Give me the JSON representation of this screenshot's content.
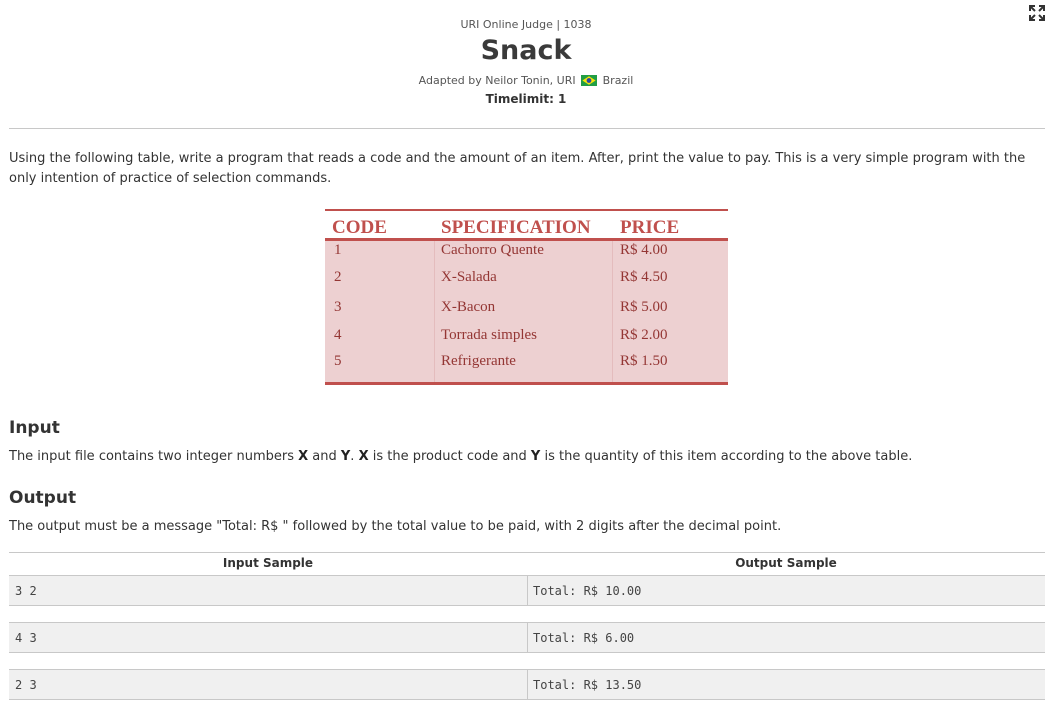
{
  "header": {
    "judge_line": "URI Online Judge | 1038",
    "title": "Snack",
    "adapted_prefix": "Adapted by Neilor Tonin, URI",
    "country": "Brazil",
    "timelimit": "Timelimit: 1"
  },
  "description": "Using the following table, write a program that reads a code and the amount of an item. After, print the value to pay. This is a very simple program with the only intention of practice of selection commands.",
  "price_table": {
    "headers": [
      "CODE",
      "SPECIFICATION",
      "PRICE"
    ],
    "rows": [
      [
        "1",
        "Cachorro Quente",
        "R$ 4.00"
      ],
      [
        "2",
        "X-Salada",
        "R$ 4.50"
      ],
      [
        "3",
        "X-Bacon",
        "R$ 5.00"
      ],
      [
        "4",
        "Torrada simples",
        "R$ 2.00"
      ],
      [
        "5",
        "Refrigerante",
        "R$ 1.50"
      ]
    ]
  },
  "input": {
    "title": "Input",
    "t1": "The input file contains two integer numbers ",
    "b1": "X",
    "t2": " and ",
    "b2": "Y",
    "t3": ". ",
    "b3": "X",
    "t4": " is the product code and ",
    "b4": "Y",
    "t5": " is the quantity of this item according to the above table."
  },
  "output": {
    "title": "Output",
    "text": "The output must be a message \"Total: R$ \" followed by the total value to be paid, with 2 digits after the decimal point."
  },
  "samples": {
    "input_header": "Input Sample",
    "output_header": "Output Sample",
    "rows": [
      {
        "input": "3 2",
        "output": "Total: R$ 10.00"
      },
      {
        "input": "4 3",
        "output": "Total: R$ 6.00"
      },
      {
        "input": "2 3",
        "output": "Total: R$ 13.50"
      }
    ]
  },
  "icons": {
    "expand": "fullscreen-expand-icon",
    "flag": "brazil-flag-icon"
  },
  "colors": {
    "table_accent": "#c0504d",
    "table_fill": "#edd0d1",
    "table_text": "#943634"
  }
}
